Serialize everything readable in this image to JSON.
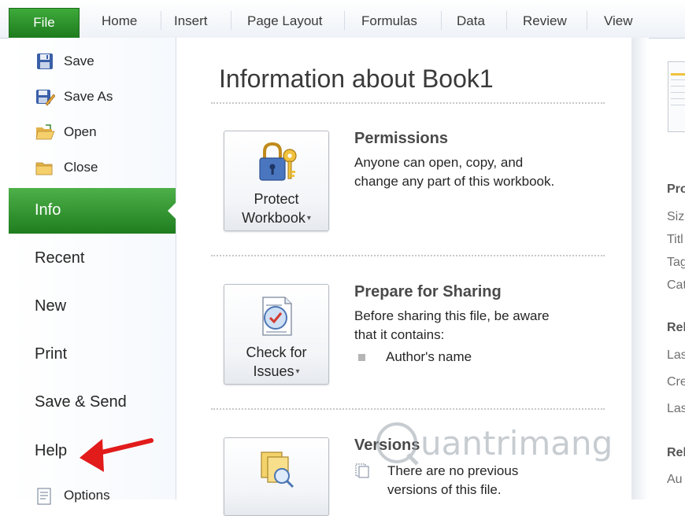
{
  "tabs": {
    "file": "File",
    "items": [
      "Home",
      "Insert",
      "Page Layout",
      "Formulas",
      "Data",
      "Review",
      "View"
    ]
  },
  "leftnav": {
    "commands": {
      "save": "Save",
      "save_as": "Save As",
      "open": "Open",
      "close": "Close"
    },
    "items": {
      "info": "Info",
      "recent": "Recent",
      "new": "New",
      "print": "Print",
      "save_send": "Save & Send",
      "help": "Help",
      "options": "Options"
    },
    "active": "Info"
  },
  "main": {
    "title": "Information about Book1",
    "permissions": {
      "button_line1": "Protect",
      "button_line2": "Workbook",
      "heading": "Permissions",
      "text_line1": "Anyone can open, copy, and",
      "text_line2": "change any part of this workbook."
    },
    "sharing": {
      "button_line1": "Check for",
      "button_line2": "Issues",
      "heading": "Prepare for Sharing",
      "text_line1": "Before sharing this file, be aware",
      "text_line2": "that it contains:",
      "bullet": "Author's name"
    },
    "versions": {
      "heading": "Versions",
      "text_line1": "There are no previous",
      "text_line2": "versions of this file."
    }
  },
  "rightpane": {
    "properties_heading": "Pro",
    "properties": [
      "Siz",
      "Titl",
      "Tag",
      "Cat"
    ],
    "dates_heading": "Rel",
    "dates": [
      "Las",
      "Cre",
      "Las"
    ],
    "people_heading": "Rel",
    "people": [
      "Au"
    ]
  },
  "watermark_text": "uantrimang",
  "colors": {
    "accent_green": "#1e7b1d",
    "arrow_red": "#e21b1b"
  },
  "icons": {
    "caret": "▾"
  }
}
